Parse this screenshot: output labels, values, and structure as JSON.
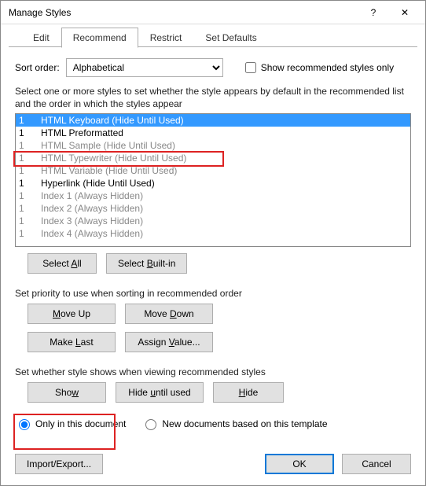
{
  "window": {
    "title": "Manage Styles"
  },
  "tabs": [
    {
      "label": "Edit",
      "active": false
    },
    {
      "label": "Recommend",
      "active": true
    },
    {
      "label": "Restrict",
      "active": false
    },
    {
      "label": "Set Defaults",
      "active": false
    }
  ],
  "sortOrder": {
    "label": "Sort order:",
    "value": "Alphabetical"
  },
  "showRecommendedOnly": {
    "label": "Show recommended styles only",
    "checked": false
  },
  "listInstruction": "Select one or more styles to set whether the style appears by default in the recommended list and the order in which the styles appear",
  "styles": [
    {
      "priority": "1",
      "name": "HTML Keyboard  (Hide Until Used)",
      "selected": true,
      "gray": true
    },
    {
      "priority": "1",
      "name": "HTML Preformatted",
      "selected": false,
      "gray": false
    },
    {
      "priority": "1",
      "name": "HTML Sample  (Hide Until Used)",
      "selected": false,
      "gray": true
    },
    {
      "priority": "1",
      "name": "HTML Typewriter  (Hide Until Used)",
      "selected": false,
      "gray": true
    },
    {
      "priority": "1",
      "name": "HTML Variable  (Hide Until Used)",
      "selected": false,
      "gray": true
    },
    {
      "priority": "1",
      "name": "Hyperlink  (Hide Until Used)",
      "selected": false,
      "gray": false
    },
    {
      "priority": "1",
      "name": "Index 1  (Always Hidden)",
      "selected": false,
      "gray": true
    },
    {
      "priority": "1",
      "name": "Index 2  (Always Hidden)",
      "selected": false,
      "gray": true
    },
    {
      "priority": "1",
      "name": "Index 3  (Always Hidden)",
      "selected": false,
      "gray": true
    },
    {
      "priority": "1",
      "name": "Index 4  (Always Hidden)",
      "selected": false,
      "gray": true
    }
  ],
  "buttons": {
    "selectAll": "Select All",
    "selectBuiltIn": "Select Built-in",
    "moveUp": "Move Up",
    "moveDown": "Move Down",
    "makeLast": "Make Last",
    "assignValue": "Assign Value...",
    "show": "Show",
    "hideUntilUsed": "Hide until used",
    "hide": "Hide",
    "importExport": "Import/Export...",
    "ok": "OK",
    "cancel": "Cancel"
  },
  "priorityLabel": "Set priority to use when sorting in recommended order",
  "visibilityLabel": "Set whether style shows when viewing recommended styles",
  "radios": {
    "onlyThisDoc": {
      "label": "Only in this document",
      "checked": true
    },
    "newDocs": {
      "label": "New documents based on this template",
      "checked": false
    }
  }
}
